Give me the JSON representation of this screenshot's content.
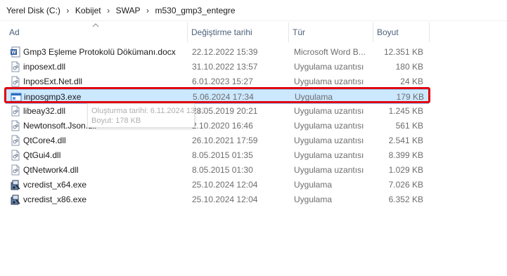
{
  "breadcrumb": {
    "items": [
      "Yerel Disk (C:)",
      "Kobijet",
      "SWAP",
      "m530_gmp3_entegre"
    ],
    "separator": "›"
  },
  "columns": {
    "name": "Ad",
    "date": "Değiştirme tarihi",
    "type": "Tür",
    "size": "Boyut"
  },
  "files": [
    {
      "name": "Gmp3 Eşleme Protokolü Dökümanı.docx",
      "date": "22.12.2022 15:39",
      "type": "Microsoft Word B...",
      "size": "12.351 KB",
      "icon": "word-doc-icon"
    },
    {
      "name": "inposext.dll",
      "date": "31.10.2022 13:57",
      "type": "Uygulama uzantısı",
      "size": "180 KB",
      "icon": "dll-file-icon"
    },
    {
      "name": "InposExt.Net.dll",
      "date": "6.01.2023 15:27",
      "type": "Uygulama uzantısı",
      "size": "24 KB",
      "icon": "dll-file-icon"
    },
    {
      "name": "inposgmp3.exe",
      "date": "5.06.2024 17:34",
      "type": "Uygulama",
      "size": "179 KB",
      "icon": "exe-app-icon"
    },
    {
      "name": "libeay32.dll",
      "date": "28.05.2019 20:21",
      "type": "Uygulama uzantısı",
      "size": "1.245 KB",
      "icon": "dll-file-icon"
    },
    {
      "name": "Newtonsoft.Json.dll",
      "date": "2.10.2020 16:46",
      "type": "Uygulama uzantısı",
      "size": "561 KB",
      "icon": "dll-file-icon"
    },
    {
      "name": "QtCore4.dll",
      "date": "26.10.2021 17:59",
      "type": "Uygulama uzantısı",
      "size": "2.541 KB",
      "icon": "dll-file-icon"
    },
    {
      "name": "QtGui4.dll",
      "date": "8.05.2015 01:35",
      "type": "Uygulama uzantısı",
      "size": "8.399 KB",
      "icon": "dll-file-icon"
    },
    {
      "name": "QtNetwork4.dll",
      "date": "8.05.2015 01:30",
      "type": "Uygulama uzantısı",
      "size": "1.029 KB",
      "icon": "dll-file-icon"
    },
    {
      "name": "vcredist_x64.exe",
      "date": "25.10.2024 12:04",
      "type": "Uygulama",
      "size": "7.026 KB",
      "icon": "installer-icon"
    },
    {
      "name": "vcredist_x86.exe",
      "date": "25.10.2024 12:04",
      "type": "Uygulama",
      "size": "6.352 KB",
      "icon": "installer-icon"
    }
  ],
  "selected_file": "inposgmp3.exe",
  "tooltip": {
    "created": "Oluşturma tarihi: 6.11.2024 13:13",
    "size": "Boyut: 178 KB"
  },
  "colors": {
    "selection_bg": "#cce8ff",
    "selection_border": "#99d1ff",
    "highlight": "#e0000f",
    "header_text": "#4c607a"
  }
}
